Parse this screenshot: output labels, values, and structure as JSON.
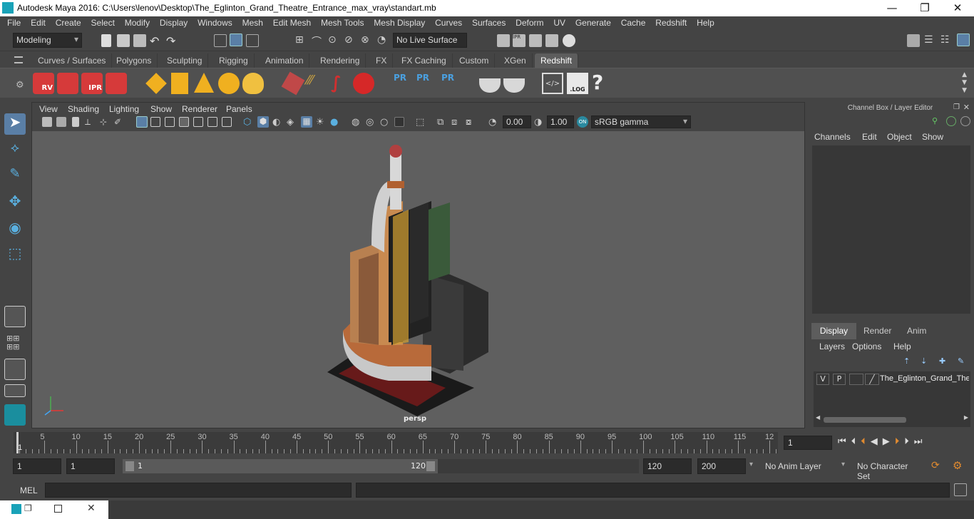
{
  "window": {
    "title": "Autodesk Maya 2016: C:\\Users\\lenov\\Desktop\\The_Eglinton_Grand_Theatre_Entrance_max_vray\\standart.mb",
    "minimize": "—",
    "restore": "❐",
    "close": "✕"
  },
  "menubar": [
    "File",
    "Edit",
    "Create",
    "Select",
    "Modify",
    "Display",
    "Windows",
    "Mesh",
    "Edit Mesh",
    "Mesh Tools",
    "Mesh Display",
    "Curves",
    "Surfaces",
    "Deform",
    "UV",
    "Generate",
    "Cache",
    "Redshift",
    "Help"
  ],
  "statusline": {
    "mode": "Modeling",
    "live_surface": "No Live Surface"
  },
  "shelf_tabs": [
    "Curves / Surfaces",
    "Polygons",
    "Sculpting",
    "Rigging",
    "Animation",
    "Rendering",
    "FX",
    "FX Caching",
    "Custom",
    "XGen",
    "Redshift"
  ],
  "shelf": {
    "rv": "RV",
    "ipr": "IPR",
    "pr": "PR",
    "log": ".LOG",
    "help": "?"
  },
  "viewport": {
    "menus": [
      "View",
      "Shading",
      "Lighting",
      "Show",
      "Renderer",
      "Panels"
    ],
    "exposure": "0.00",
    "gamma": "1.00",
    "colorspace": "sRGB gamma",
    "camera_label": "persp"
  },
  "channel_box": {
    "title": "Channel Box / Layer Editor",
    "menus": [
      "Channels",
      "Edit",
      "Object",
      "Show"
    ]
  },
  "layer_editor": {
    "tabs": [
      "Display",
      "Render",
      "Anim"
    ],
    "menus": [
      "Layers",
      "Options",
      "Help"
    ],
    "layer": {
      "v": "V",
      "p": "P",
      "name": "The_Eglinton_Grand_The"
    }
  },
  "timeline": {
    "ticks": [
      "5",
      "10",
      "15",
      "20",
      "25",
      "30",
      "35",
      "40",
      "45",
      "50",
      "55",
      "60",
      "65",
      "70",
      "75",
      "80",
      "85",
      "90",
      "95",
      "100",
      "105",
      "110",
      "115",
      "12"
    ],
    "start_marker": "1",
    "current_frame": "1"
  },
  "range": {
    "start": "1",
    "anim_start": "1",
    "slider_start": "1",
    "slider_end": "120",
    "end": "120",
    "anim_end": "200",
    "anim_layer": "No Anim Layer",
    "character_set": "No Character Set"
  },
  "command": {
    "label": "MEL"
  }
}
